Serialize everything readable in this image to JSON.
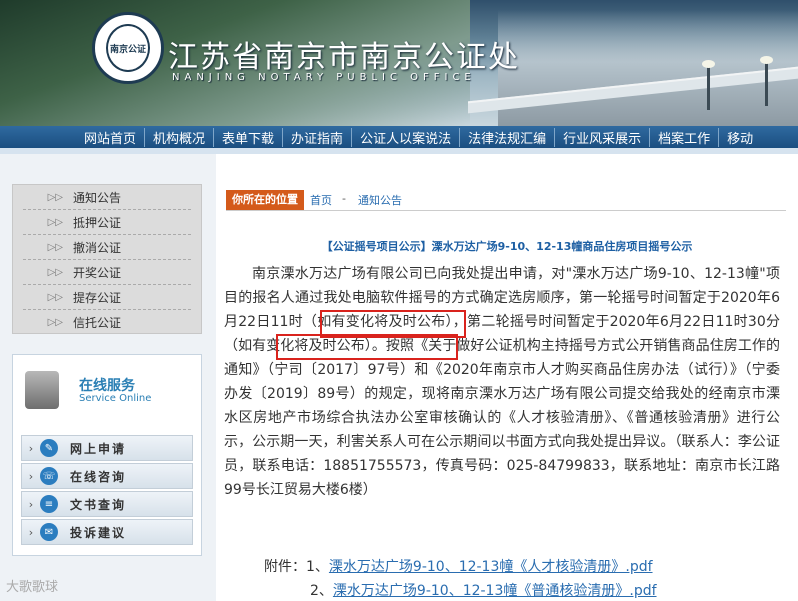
{
  "header": {
    "title_cn": "江苏省南京市南京公证处",
    "title_en": "NANJING NOTARY PUBLIC OFFICE",
    "seal_text": "南京公证"
  },
  "nav": [
    "网站首页",
    "机构概况",
    "表单下载",
    "办证指南",
    "公证人以案说法",
    "法律法规汇编",
    "行业风采展示",
    "档案工作",
    "移动"
  ],
  "sidebar": {
    "menu": [
      "通知公告",
      "抵押公证",
      "撤消公证",
      "开奖公证",
      "提存公证",
      "信托公证"
    ],
    "service_title": "在线服务",
    "service_subtitle": "Service Online",
    "service_items": [
      "网上申请",
      "在线咨询",
      "文书查询",
      "投诉建议"
    ],
    "watermark": "大歌歌球"
  },
  "breadcrumb": {
    "tag": "你所在的位置",
    "home": "首页",
    "separator": "-",
    "current": "通知公告"
  },
  "article": {
    "title": "【公证摇号项目公示】溧水万达广场9-10、12-13幢商品住房项目摇号公示",
    "body": "南京溧水万达广场有限公司已向我处提出申请，对\"溧水万达广场9-10、12-13幢\"项目的报名人通过我处电脑软件摇号的方式确定选房顺序，第一轮摇号时间暂定于2020年6月22日11时（如有变化将及时公布），第二轮摇号时间暂定于2020年6月22日11时30分（如有变化将及时公布）。按照《关于做好公证机构主持摇号方式公开销售商品住房工作的通知》（宁司〔2017〕97号）和《2020年南京市人才购买商品住房办法（试行）》（宁委办发〔2019〕89号）的规定，现将南京溧水万达广场有限公司提交给我处的经南京市溧水区房地产市场综合执法办公室审核确认的《人才核验清册》、《普通核验清册》进行公示，公示期一天，利害关系人可在公示期间以书面方式向我处提出异议。（联系人：李公证员，联系电话：18851755573，传真号码：025-84799833，联系地址：南京市长江路99号长江贸易大楼6楼）",
    "attachment_label": "附件：",
    "attachments": [
      {
        "index": "1、",
        "text": "溧水万达广场9-10、12-13幢《人才核验清册》.pdf"
      },
      {
        "index": "2、",
        "text": "溧水万达广场9-10、12-13幢《普通核验清册》.pdf"
      }
    ]
  },
  "colors": {
    "nav": "#1b4e80",
    "crumb_tag": "#d45a1a",
    "highlight": "#d9231d",
    "link": "#2a6db0"
  }
}
